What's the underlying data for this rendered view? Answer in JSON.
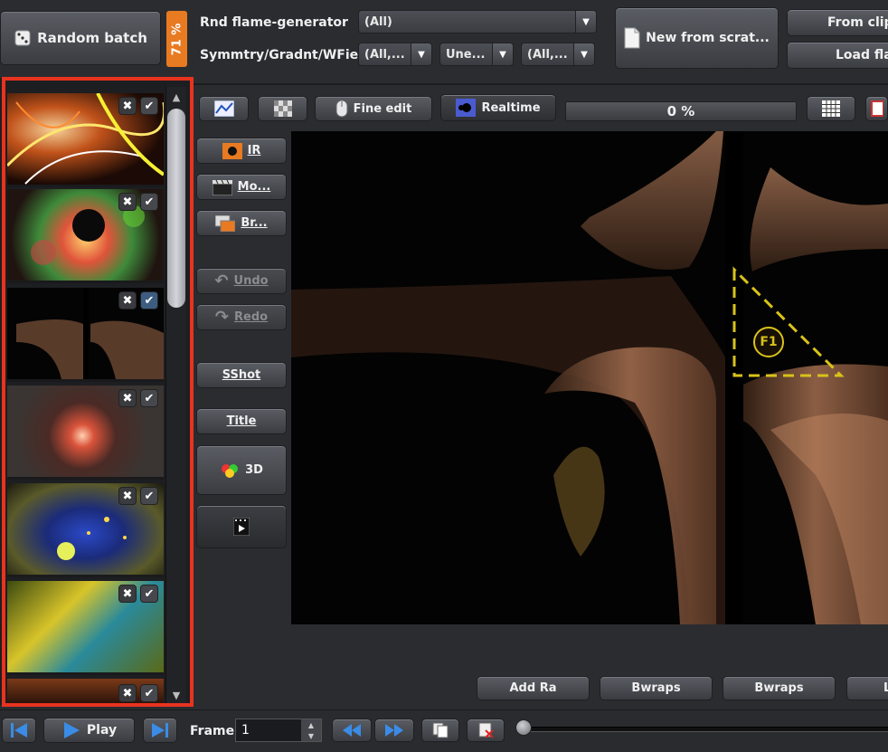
{
  "top": {
    "random_batch_label": "Random batch",
    "progress_vertical": "71 %",
    "rnd_label": "Rnd flame-generator",
    "rnd_value": "(All)",
    "sym_label": "Symmtry/Gradnt/WField",
    "sym_value1": "(All,...",
    "sym_value2": "Une...",
    "sym_value3": "(All,...",
    "new_label": "New from scrat...",
    "from_clip_label": "From clipb",
    "load_flame_label": "Load flam"
  },
  "toolbar": {
    "fine_edit_label": "Fine edit",
    "realtime_label": "Realtime",
    "progress_text": "0 %",
    "progress_value": 0
  },
  "side": {
    "ir": "IR",
    "movie": "Mo...",
    "browse": "Br...",
    "undo": "Undo",
    "redo": "Redo",
    "sshot": "SShot",
    "title": "Title",
    "three_d": "3D"
  },
  "canvas": {
    "handle_label": "F1"
  },
  "bottom_buttons": [
    "Add Ra",
    "Bwraps",
    "Bwraps",
    "L"
  ],
  "transport": {
    "play_label": "Play",
    "frame_label": "Frame",
    "frame_value": "1"
  },
  "colors": {
    "accent_orange": "#e87a22",
    "highlight_red": "#e8331f",
    "handle_yellow": "#d9c21a"
  }
}
